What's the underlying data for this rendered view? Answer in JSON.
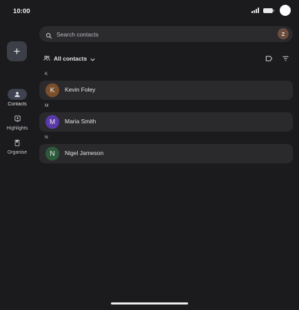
{
  "status_bar": {
    "time": "10:00"
  },
  "nav": {
    "fab_label": "+",
    "items": [
      {
        "label": "Contacts",
        "icon": "person-icon",
        "active": true
      },
      {
        "label": "Highlights",
        "icon": "highlights-icon",
        "active": false
      },
      {
        "label": "Organise",
        "icon": "organise-icon",
        "active": false
      }
    ]
  },
  "search": {
    "placeholder": "Search contacts",
    "account_initial": "Z"
  },
  "filter": {
    "label": "All contacts"
  },
  "sections": [
    {
      "letter": "K",
      "contacts": [
        {
          "initial": "K",
          "name": "Kevin Foley",
          "color": "#7a4f2c"
        }
      ]
    },
    {
      "letter": "M",
      "contacts": [
        {
          "initial": "M",
          "name": "Maria Smith",
          "color": "#5a3aa8"
        }
      ]
    },
    {
      "letter": "N",
      "contacts": [
        {
          "initial": "N",
          "name": "Nigel Jameson",
          "color": "#2c5a3a"
        }
      ]
    }
  ],
  "colors": {
    "background": "#1b1b1d",
    "row": "#2a2a2d",
    "accent": "#3f4250"
  }
}
